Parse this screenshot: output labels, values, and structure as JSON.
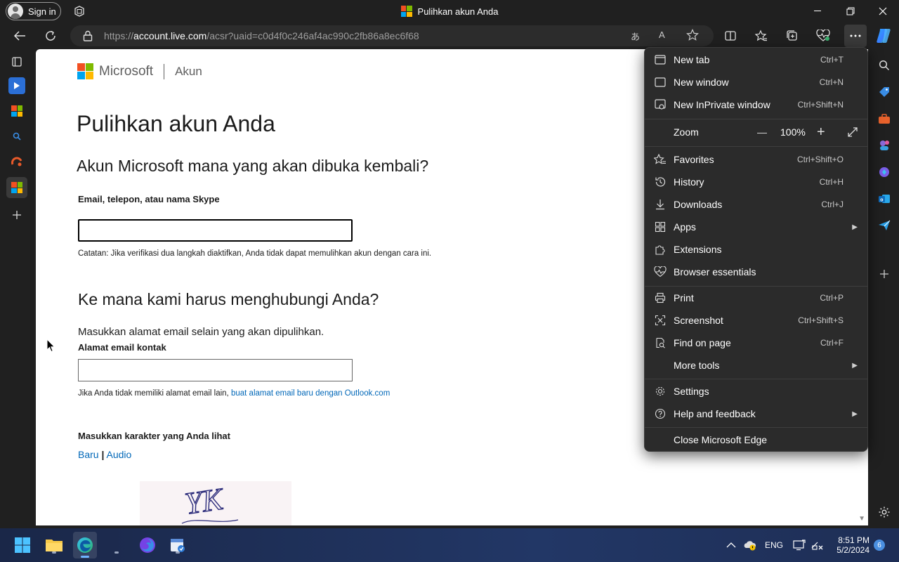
{
  "window": {
    "title": "Pulihkan akun Anda",
    "sign_in_label": "Sign in"
  },
  "address": {
    "url_prefix": "https://",
    "url_domain": "account.live.com",
    "url_path": "/acsr?uaid=c0d4f0c246af4ac990c2fb86a8ec6f68"
  },
  "page": {
    "brand_name": "Microsoft",
    "brand_sub": "Akun",
    "heading": "Pulihkan akun Anda",
    "question": "Akun Microsoft mana yang akan dibuka kembali?",
    "account_label": "Email, telepon, atau nama Skype",
    "account_value": "",
    "account_note": "Catatan: Jika verifikasi dua langkah diaktifkan, Anda tidak dapat memulihkan akun dengan cara ini.",
    "contact_heading": "Ke mana kami harus menghubungi Anda?",
    "contact_text": "Masukkan alamat email selain yang akan dipulihkan.",
    "contact_label": "Alamat email kontak",
    "contact_value": "",
    "contact_note": "Jika Anda tidak memiliki alamat email lain,",
    "contact_link": "buat alamat email baru dengan Outlook.com",
    "captcha_label": "Masukkan karakter yang Anda lihat",
    "captcha_new": "Baru",
    "captcha_sep": "|",
    "captcha_audio": "Audio",
    "captcha_text": "YK"
  },
  "menu": {
    "new_tab": {
      "label": "New tab",
      "shortcut": "Ctrl+T"
    },
    "new_window": {
      "label": "New window",
      "shortcut": "Ctrl+N"
    },
    "new_inprivate": {
      "label": "New InPrivate window",
      "shortcut": "Ctrl+Shift+N"
    },
    "zoom": {
      "label": "Zoom",
      "value": "100%",
      "minus": "—",
      "plus": "+"
    },
    "favorites": {
      "label": "Favorites",
      "shortcut": "Ctrl+Shift+O"
    },
    "history": {
      "label": "History",
      "shortcut": "Ctrl+H"
    },
    "downloads": {
      "label": "Downloads",
      "shortcut": "Ctrl+J"
    },
    "apps": {
      "label": "Apps"
    },
    "extensions": {
      "label": "Extensions"
    },
    "browser_essentials": {
      "label": "Browser essentials"
    },
    "print": {
      "label": "Print",
      "shortcut": "Ctrl+P"
    },
    "screenshot": {
      "label": "Screenshot",
      "shortcut": "Ctrl+Shift+S"
    },
    "find": {
      "label": "Find on page",
      "shortcut": "Ctrl+F"
    },
    "more_tools": {
      "label": "More tools"
    },
    "settings": {
      "label": "Settings"
    },
    "help": {
      "label": "Help and feedback"
    },
    "close": {
      "label": "Close Microsoft Edge"
    }
  },
  "taskbar": {
    "lang": "ENG",
    "time": "8:51 PM",
    "date": "5/2/2024",
    "notification_count": "6"
  },
  "colors": {
    "accent_link": "#0067b8",
    "chrome_bg": "#202020",
    "menu_bg": "#2b2b2b"
  }
}
